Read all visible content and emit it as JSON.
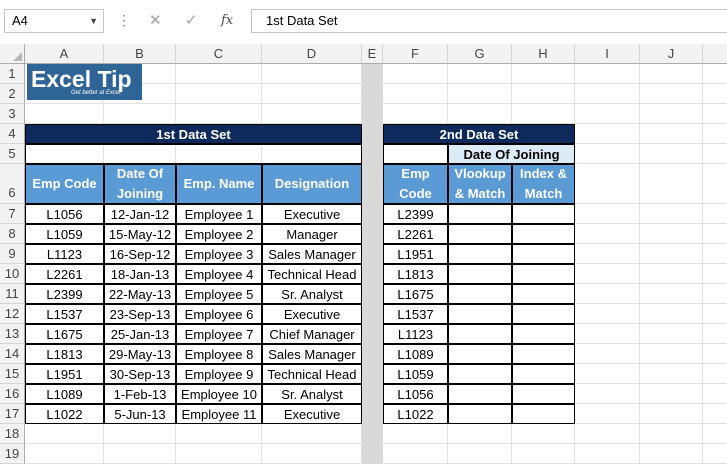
{
  "namebox": "A4",
  "formula_text": "1st Data Set",
  "formula_buttons": {
    "cancel": "✕",
    "enter": "✓",
    "fx": "fx"
  },
  "columns": [
    "A",
    "B",
    "C",
    "D",
    "E",
    "F",
    "G",
    "H",
    "I",
    "J"
  ],
  "rows": [
    "1",
    "2",
    "3",
    "4",
    "5",
    "6",
    "7",
    "8",
    "9",
    "10",
    "11",
    "12",
    "13",
    "14",
    "15",
    "16",
    "17",
    "18",
    "19"
  ],
  "logo": {
    "title": "Excel Tip",
    "tagline": "Get better at Excel"
  },
  "set1": {
    "title": "1st Data Set",
    "headers": [
      "Emp Code",
      "Date Of Joining",
      "Emp. Name",
      "Designation"
    ],
    "rows": [
      [
        "L1056",
        "12-Jan-12",
        "Employee 1",
        "Executive"
      ],
      [
        "L1059",
        "15-May-12",
        "Employee 2",
        "Manager"
      ],
      [
        "L1123",
        "16-Sep-12",
        "Employee 3",
        "Sales Manager"
      ],
      [
        "L2261",
        "18-Jan-13",
        "Employee 4",
        "Technical Head"
      ],
      [
        "L2399",
        "22-May-13",
        "Employee 5",
        "Sr. Analyst"
      ],
      [
        "L1537",
        "23-Sep-13",
        "Employee 6",
        "Executive"
      ],
      [
        "L1675",
        "25-Jan-13",
        "Employee 7",
        "Chief Manager"
      ],
      [
        "L1813",
        "29-May-13",
        "Employee 8",
        "Sales Manager"
      ],
      [
        "L1951",
        "30-Sep-13",
        "Employee 9",
        "Technical Head"
      ],
      [
        "L1089",
        "1-Feb-13",
        "Employee 10",
        "Sr. Analyst"
      ],
      [
        "L1022",
        "5-Jun-13",
        "Employee 11",
        "Executive"
      ]
    ]
  },
  "set2": {
    "title": "2nd Data Set",
    "subtitle": "Date Of Joining",
    "headers": [
      "Emp Code",
      "Vlookup & Match",
      "Index & Match"
    ],
    "codes": [
      "L2399",
      "L2261",
      "L1951",
      "L1813",
      "L1675",
      "L1537",
      "L1123",
      "L1089",
      "L1059",
      "L1056",
      "L1022"
    ]
  },
  "colors": {
    "navy": "#0e2a5c",
    "header_blue": "#5b9bd5",
    "light_blue": "#ddebf7",
    "logo": "#2f6496"
  }
}
